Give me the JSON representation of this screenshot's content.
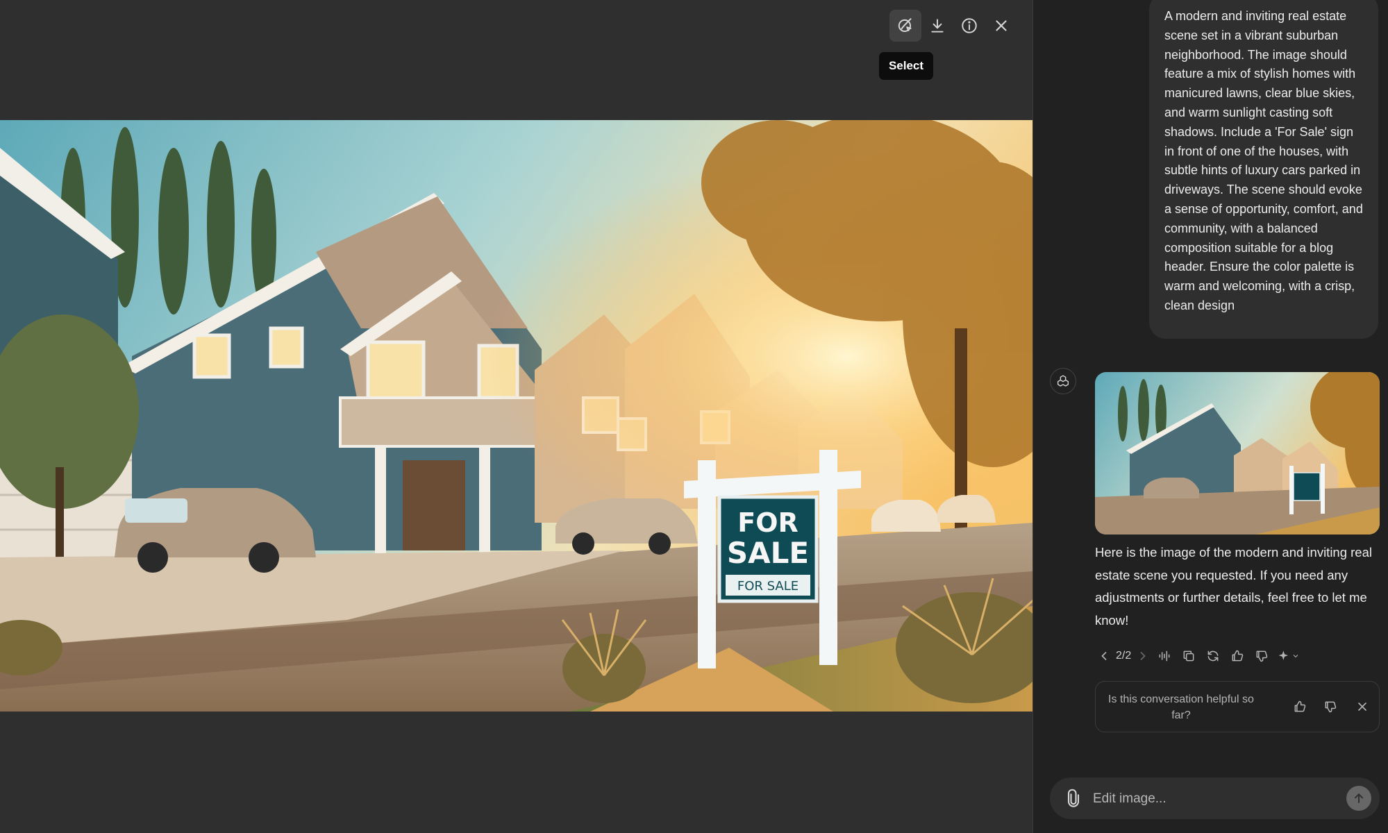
{
  "toolbar": {
    "select_tooltip": "Select",
    "icons": [
      "select-icon",
      "download-icon",
      "info-icon",
      "close-icon"
    ]
  },
  "image": {
    "sign_top": "FOR",
    "sign_middle": "SALE",
    "sign_bottom": "FOR SALE"
  },
  "sidebar": {
    "prompt": "A modern and inviting real estate scene set in a vibrant suburban neighborhood. The image should feature a mix of stylish homes with manicured lawns, clear blue skies, and warm sunlight casting soft shadows. Include a 'For Sale' sign in front of one of the houses, with subtle hints of luxury cars parked in driveways. The scene should evoke a sense of opportunity, comfort, and community, with a balanced composition suitable for a blog header. Ensure the color palette is warm and welcoming, with a crisp, clean design",
    "reply": "Here is the image of the modern and inviting real estate scene you requested. If you need any adjustments or further details, feel free to let me know!",
    "pager": "2/2",
    "feedback_question": "Is this conversation helpful so far?",
    "composer_placeholder": "Edit image..."
  },
  "colors": {
    "viewer_bg": "#2f2f2f",
    "sidebar_bg": "#212121",
    "bubble_bg": "#2f2f2f",
    "sign_green": "#0f4b55"
  }
}
